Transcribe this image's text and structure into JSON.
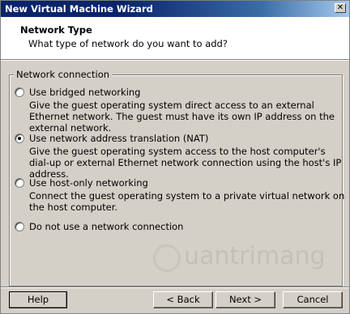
{
  "window": {
    "title": "New Virtual Machine Wizard",
    "close_glyph": "✕"
  },
  "header": {
    "title": "Network Type",
    "subtitle": "What type of network do you want to add?"
  },
  "group": {
    "label": "Network connection"
  },
  "options": [
    {
      "label": "Use bridged networking",
      "checked": false,
      "description": "Give the guest operating system direct access to an external Ethernet network. The guest must have its own IP address on the external network."
    },
    {
      "label": "Use network address translation (NAT)",
      "checked": true,
      "description": "Give the guest operating system access to the host computer's dial-up or external Ethernet network connection using the host's IP address."
    },
    {
      "label": "Use host-only networking",
      "checked": false,
      "description": "Connect the guest operating system to a private virtual network on the host computer."
    },
    {
      "label": "Do not use a network connection",
      "checked": false,
      "description": ""
    }
  ],
  "buttons": {
    "help": "Help",
    "back": "< Back",
    "next": "Next >",
    "cancel": "Cancel"
  },
  "watermark": {
    "text": "uantrimang"
  }
}
